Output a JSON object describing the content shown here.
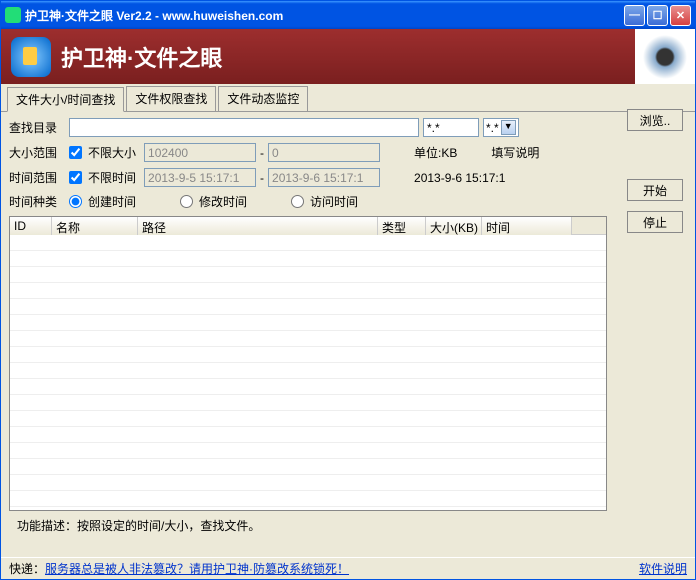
{
  "window": {
    "title": "护卫神·文件之眼 Ver2.2 - www.huweishen.com"
  },
  "banner": {
    "title": "护卫神·文件之眼"
  },
  "tabs": [
    "文件大小/时间查找",
    "文件权限查找",
    "文件动态监控"
  ],
  "active_tab": 0,
  "search": {
    "dir_label": "查找目录",
    "dir_value": "",
    "ext_filter": "*.*",
    "ext_combo": "*.*",
    "browse": "浏览..",
    "size_label": "大小范围",
    "no_size_limit": "不限大小",
    "size_from": "102400",
    "size_to": "0",
    "size_sep": "-",
    "unit_label": "单位:KB",
    "fill_hint": "填写说明",
    "time_label": "时间范围",
    "no_time_limit": "不限时间",
    "time_from": "2013-9-5 15:17:1",
    "time_to": "2013-9-6 15:17:1",
    "time_now": "2013-9-6 15:17:1",
    "kind_label": "时间种类",
    "kind_create": "创建时间",
    "kind_modify": "修改时间",
    "kind_access": "访问时间",
    "start": "开始",
    "stop": "停止"
  },
  "columns": {
    "id": "ID",
    "name": "名称",
    "path": "路径",
    "type": "类型",
    "size": "大小(KB)",
    "time": "时间"
  },
  "func_desc": "功能描述：按照设定的时间/大小，查找文件。",
  "footer": {
    "label": "快递：",
    "link_text": "服务器总是被人非法篡改？请用护卫神·防篡改系统锁死！",
    "help": "软件说明"
  }
}
